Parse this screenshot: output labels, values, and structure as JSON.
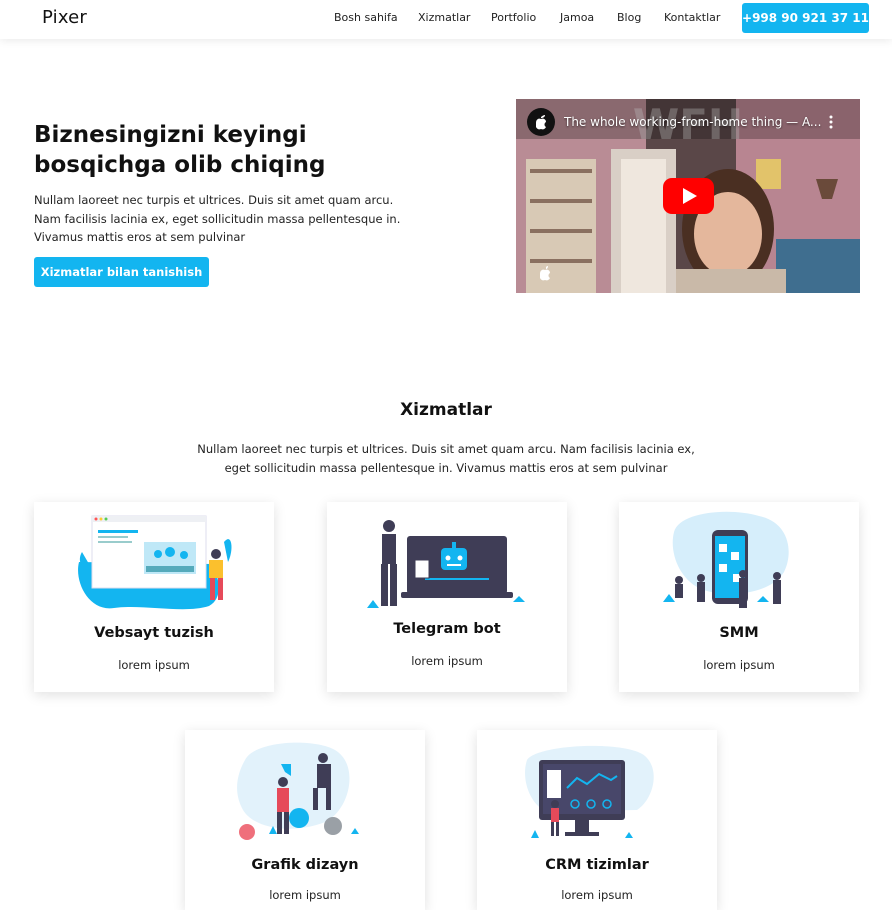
{
  "header": {
    "logo": "Pixer",
    "nav": [
      "Bosh sahifa",
      "Xizmatlar",
      "Portfolio",
      "Jamoa",
      "Blog",
      "Kontaktlar"
    ],
    "phone": "+998 90 921 37 11"
  },
  "hero": {
    "title": "Biznesingizni keyingi bosqichga olib chiqing",
    "description": "Nullam laoreet nec turpis et ultrices. Duis sit amet quam arcu. Nam facilisis lacinia ex, eget sollicitudin massa pellentesque in. Vivamus mattis eros at sem pulvinar",
    "button": "Xizmatlar bilan tanishish",
    "video": {
      "title": "The whole working-from-home thing — A...",
      "overlay_text": "WFH"
    }
  },
  "services": {
    "title": "Xizmatlar",
    "description": "Nullam laoreet nec turpis et ultrices. Duis sit amet quam arcu. Nam facilisis lacinia ex, eget sollicitudin massa pellentesque in. Vivamus mattis eros at sem pulvinar",
    "cards": [
      {
        "title": "Vebsayt tuzish",
        "subtitle": "lorem ipsum",
        "icon": "website-illustration-icon"
      },
      {
        "title": "Telegram bot",
        "subtitle": "lorem ipsum",
        "icon": "telegram-bot-illustration-icon"
      },
      {
        "title": "SMM",
        "subtitle": "lorem ipsum",
        "icon": "smm-illustration-icon"
      },
      {
        "title": "Grafik dizayn",
        "subtitle": "lorem ipsum",
        "icon": "graphic-design-illustration-icon"
      },
      {
        "title": "CRM tizimlar",
        "subtitle": "lorem ipsum",
        "icon": "crm-illustration-icon"
      }
    ]
  },
  "colors": {
    "accent": "#13b5f0",
    "text": "#111111",
    "illustration_dark": "#3f3d56"
  }
}
